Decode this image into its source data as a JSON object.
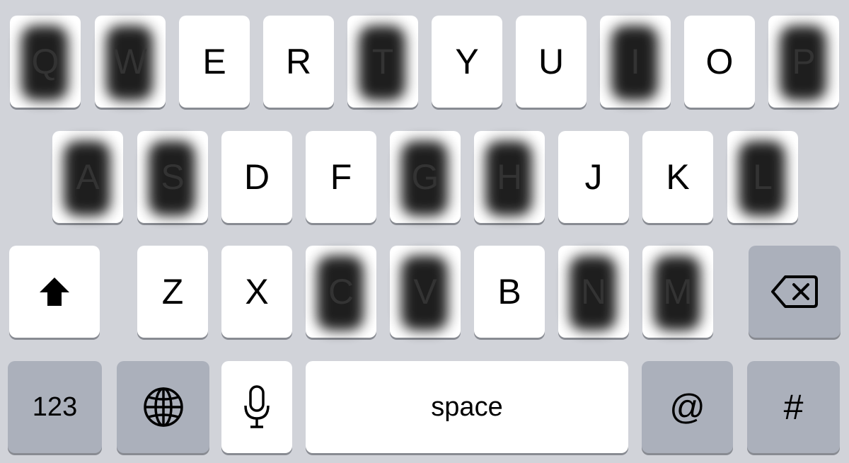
{
  "keyboard": {
    "row1": [
      "Q",
      "W",
      "E",
      "R",
      "T",
      "Y",
      "U",
      "I",
      "O",
      "P"
    ],
    "row2": [
      "A",
      "S",
      "D",
      "F",
      "G",
      "H",
      "J",
      "K",
      "L"
    ],
    "row3": [
      "Z",
      "X",
      "C",
      "V",
      "B",
      "N",
      "M"
    ],
    "bottom": {
      "numbers_label": "123",
      "space_label": "space",
      "at_label": "@",
      "hash_label": "#"
    },
    "icons": {
      "shift": "shift-arrow-up-icon",
      "delete": "backspace-icon",
      "globe": "globe-icon",
      "mic": "microphone-icon"
    },
    "colors": {
      "background": "#d1d3d9",
      "letter_key": "#ffffff",
      "function_key": "#abb0bb",
      "smudge": "#0b0b0b"
    }
  }
}
